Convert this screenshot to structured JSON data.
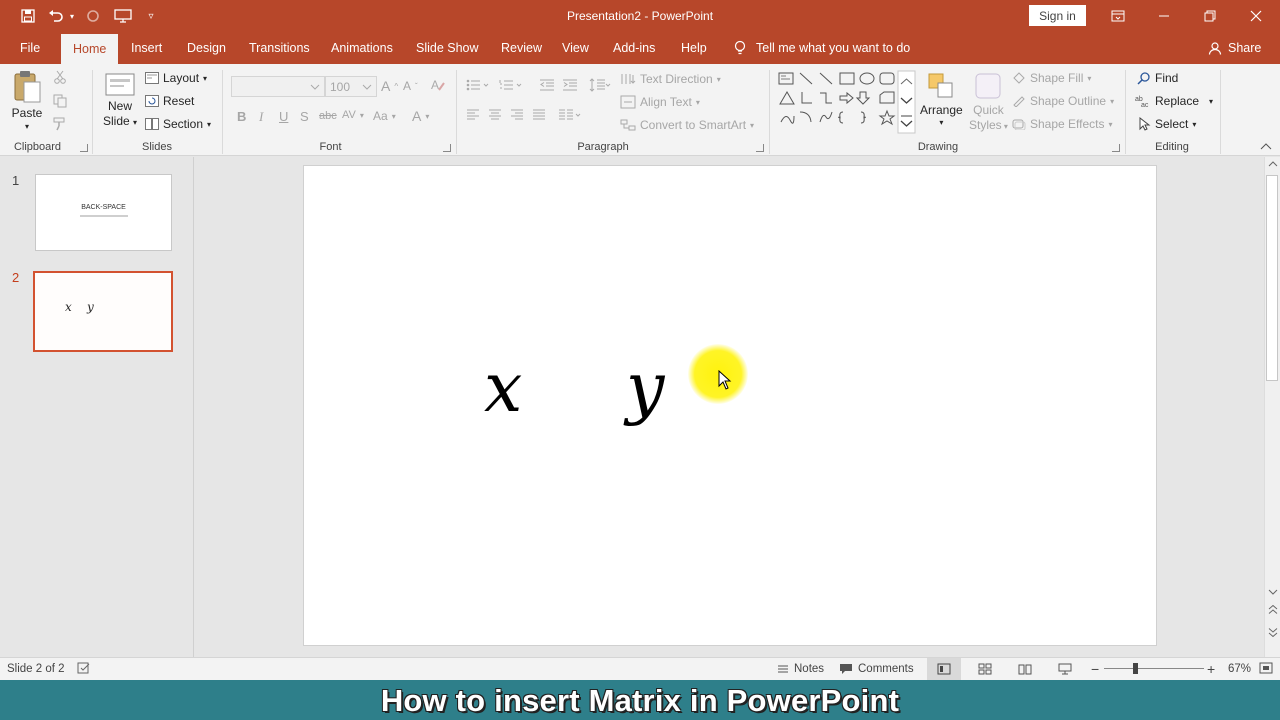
{
  "window": {
    "title": "Presentation2  -  PowerPoint",
    "sign_in": "Sign in"
  },
  "tabs": [
    {
      "label": "File"
    },
    {
      "label": "Home"
    },
    {
      "label": "Insert"
    },
    {
      "label": "Design"
    },
    {
      "label": "Transitions"
    },
    {
      "label": "Animations"
    },
    {
      "label": "Slide Show"
    },
    {
      "label": "Review"
    },
    {
      "label": "View"
    },
    {
      "label": "Add-ins"
    },
    {
      "label": "Help"
    }
  ],
  "tell_me": "Tell me what you want to do",
  "share": "Share",
  "ribbon": {
    "clipboard": {
      "label": "Clipboard",
      "paste": "Paste"
    },
    "slides": {
      "label": "Slides",
      "new_slide": "New",
      "new_slide_2": "Slide",
      "layout": "Layout",
      "reset": "Reset",
      "section": "Section"
    },
    "font": {
      "label": "Font",
      "size": "100",
      "font_color": "A",
      "change_case": "Aa"
    },
    "paragraph": {
      "label": "Paragraph",
      "text_direction": "Text Direction",
      "align_text": "Align Text",
      "convert_smartart": "Convert to SmartArt"
    },
    "drawing": {
      "label": "Drawing",
      "arrange": "Arrange",
      "quick_styles": "Quick",
      "quick_styles_2": "Styles",
      "shape_fill": "Shape Fill",
      "shape_outline": "Shape Outline",
      "shape_effects": "Shape Effects"
    },
    "editing": {
      "label": "Editing",
      "find": "Find",
      "replace": "Replace",
      "select": "Select"
    }
  },
  "thumbnails": [
    {
      "number": "1",
      "title": "BACK-SPACE"
    },
    {
      "number": "2",
      "var_x": "x",
      "var_y": "y"
    }
  ],
  "slide": {
    "var_x": "x",
    "var_y": "y"
  },
  "status": {
    "slide_info": "Slide 2 of 2",
    "notes": "Notes",
    "comments": "Comments",
    "zoom": "67%"
  },
  "banner": "How to insert Matrix in PowerPoint",
  "colors": {
    "accent": "#b7472a",
    "banner": "#2e7f8a",
    "cursor_highlight": "#fff200"
  }
}
